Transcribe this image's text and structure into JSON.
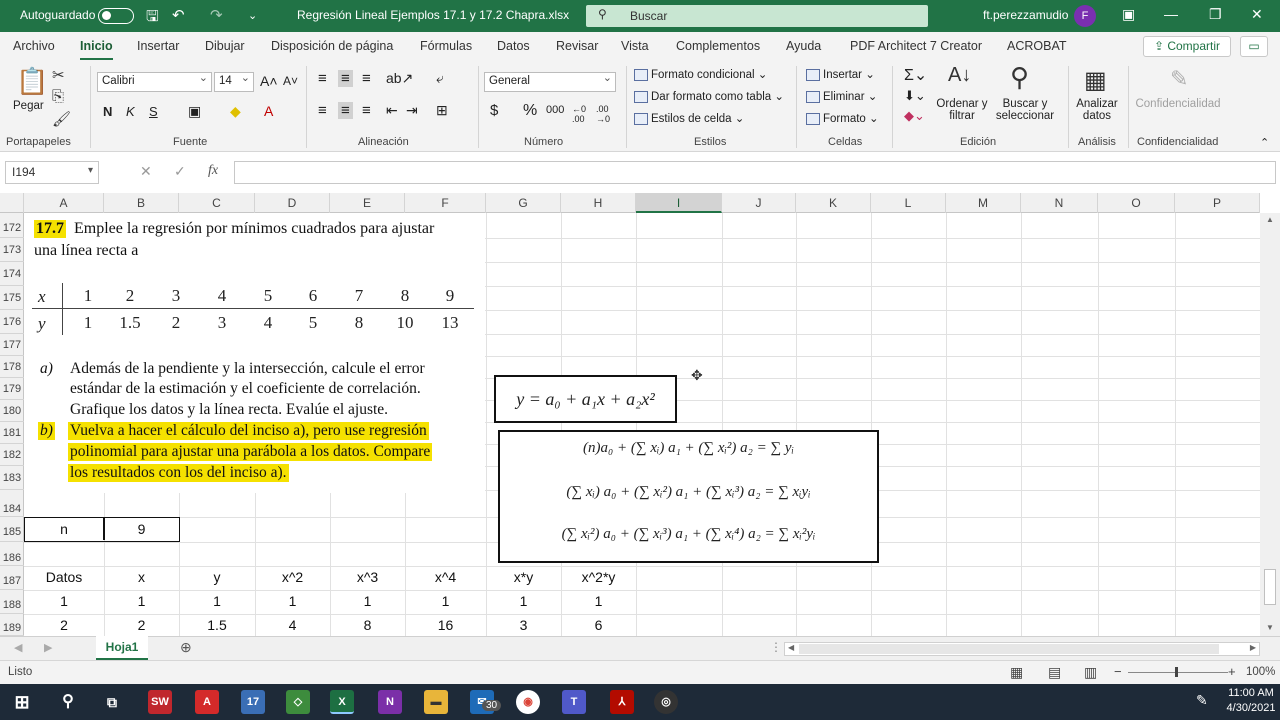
{
  "titlebar": {
    "autosave": "Autoguardado",
    "filename": "Regresión Lineal Ejemplos 17.1 y 17.2 Chapra.xlsx",
    "search_placeholder": "Buscar",
    "user": "ft.perezzamudio",
    "avatar_letter": "F"
  },
  "tabs": [
    "Archivo",
    "Inicio",
    "Insertar",
    "Dibujar",
    "Disposición de página",
    "Fórmulas",
    "Datos",
    "Revisar",
    "Vista",
    "Complementos",
    "Ayuda",
    "PDF Architect 7 Creator",
    "ACROBAT"
  ],
  "share": "Compartir",
  "ribbon": {
    "paste": "Pegar",
    "font_name": "Calibri",
    "font_size": "14",
    "number_format": "General",
    "cond_format": "Formato condicional",
    "table_format": "Dar formato como tabla",
    "cell_styles": "Estilos de celda",
    "insert": "Insertar",
    "delete": "Eliminar",
    "format": "Formato",
    "sort_filter": [
      "Ordenar y",
      "filtrar"
    ],
    "find_select": [
      "Buscar y",
      "seleccionar"
    ],
    "analyze": [
      "Analizar",
      "datos"
    ],
    "confidentiality": "Confidencialidad",
    "groups": {
      "clipboard": "Portapapeles",
      "font": "Fuente",
      "alignment": "Alineación",
      "number": "Número",
      "styles": "Estilos",
      "cells": "Celdas",
      "editing": "Edición",
      "analysis": "Análisis",
      "confidentiality": "Confidencialidad"
    }
  },
  "namebox": "I194",
  "columns": [
    "A",
    "B",
    "C",
    "D",
    "E",
    "F",
    "G",
    "H",
    "I",
    "J",
    "K",
    "L",
    "M",
    "N",
    "O",
    "P"
  ],
  "rows": [
    "172",
    "173",
    "174",
    "175",
    "176",
    "177",
    "178",
    "179",
    "180",
    "181",
    "182",
    "183",
    "184",
    "185",
    "186",
    "187",
    "188",
    "189"
  ],
  "problem": {
    "number": "17.7",
    "statement_l1": "Emplee la regresión por mínimos cuadrados para ajustar",
    "statement_l2": "una línea recta a",
    "x_label": "x",
    "y_label": "y",
    "x_values": [
      "1",
      "2",
      "3",
      "4",
      "5",
      "6",
      "7",
      "8",
      "9"
    ],
    "y_values": [
      "1",
      "1.5",
      "2",
      "3",
      "4",
      "5",
      "8",
      "10",
      "13"
    ],
    "a_label": "a)",
    "a_l1": "Además de la pendiente y la intersección, calcule el error",
    "a_l2": "estándar de la estimación y el coeficiente de correlación.",
    "a_l3": "Grafique los datos y la línea recta. Evalúe el ajuste.",
    "b_label": "b)",
    "b_l1": "Vuelva a hacer el cálculo del inciso a), pero use regresión",
    "b_l2": "polinomial para ajustar una parábola a los datos. Compare",
    "b_l3": "los resultados con los del inciso a)."
  },
  "equation_model": "y = a₀ + a₁x + a₂x²",
  "normal_equations": [
    "(n)a₀ + (∑ xᵢ) a₁ + (∑ xᵢ²) a₂ = ∑ yᵢ",
    "(∑ xᵢ) a₀ + (∑ xᵢ²) a₁ + (∑ xᵢ³) a₂ = ∑ xᵢyᵢ",
    "(∑ xᵢ²) a₀ + (∑ xᵢ³) a₁ + (∑ xᵢ⁴) a₂ = ∑ xᵢ²yᵢ"
  ],
  "n_cell": {
    "label": "n",
    "value": "9"
  },
  "table": {
    "headers": [
      "Datos",
      "x",
      "y",
      "x^2",
      "x^3",
      "x^4",
      "x*y",
      "x^2*y"
    ],
    "rows": [
      [
        "1",
        "1",
        "1",
        "1",
        "1",
        "1",
        "1",
        "1"
      ],
      [
        "2",
        "2",
        "1.5",
        "4",
        "8",
        "16",
        "3",
        "6"
      ]
    ]
  },
  "sheet_tab": "Hoja1",
  "status": "Listo",
  "zoom": "100%",
  "clock": {
    "time": "11:00 AM",
    "date": "4/30/2021"
  },
  "taskbar_badge": "30"
}
